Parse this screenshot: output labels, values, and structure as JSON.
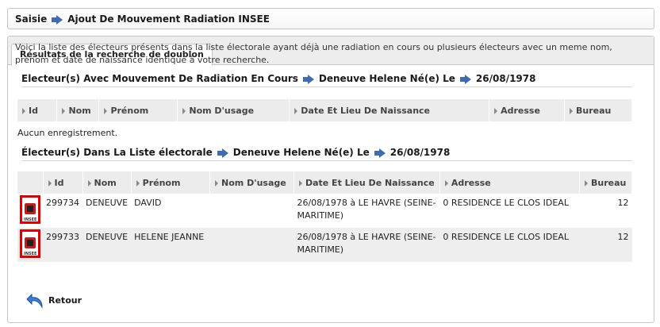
{
  "breadcrumb": {
    "root": "Saisie",
    "current": "Ajout De Mouvement Radiation INSEE"
  },
  "tab": {
    "label": "Résultats de la recherche de doublon"
  },
  "intro": "Voici la liste des électeurs présents dans la liste électorale ayant déjà une radiation en cours ou plusieurs électeurs avec un meme nom, prénom et date de naissance identique à votre recherche.",
  "section1": {
    "title": "Electeur(s) Avec Mouvement De Radiation En Cours",
    "name": "Deneuve Helene Né(e) Le",
    "date": "26/08/1978",
    "columns": [
      "Id",
      "Nom",
      "Prénom",
      "Nom D'usage",
      "Date Et Lieu De Naissance",
      "Adresse",
      "Bureau"
    ],
    "empty": "Aucun enregistrement."
  },
  "section2": {
    "title": "Électeur(s) Dans La Liste électorale",
    "name": "Deneuve Helene Né(e) Le",
    "date": "26/08/1978",
    "columns": [
      "Id",
      "Nom",
      "Prénom",
      "Nom D'usage",
      "Date Et Lieu De Naissance",
      "Adresse",
      "Bureau"
    ],
    "rows": [
      {
        "id": "299734",
        "nom": "DENEUVE",
        "prenom": "DAVID",
        "nom_usage": "",
        "naissance": "26/08/1978 à LE HAVRE (SEINE-MARITIME)",
        "adresse": "0 RESIDENCE LE CLOS IDEAL",
        "bureau": "12",
        "icon_label": "INSEE"
      },
      {
        "id": "299733",
        "nom": "DENEUVE",
        "prenom": "HELENE JEANNE",
        "nom_usage": "",
        "naissance": "26/08/1978 à LE HAVRE (SEINE-MARITIME)",
        "adresse": "0 RESIDENCE LE CLOS IDEAL",
        "bureau": "12",
        "icon_label": "INSEE"
      }
    ]
  },
  "back": {
    "label": "Retour"
  },
  "colors": {
    "accent": "#3f6cae",
    "highlight": "#e00000"
  }
}
